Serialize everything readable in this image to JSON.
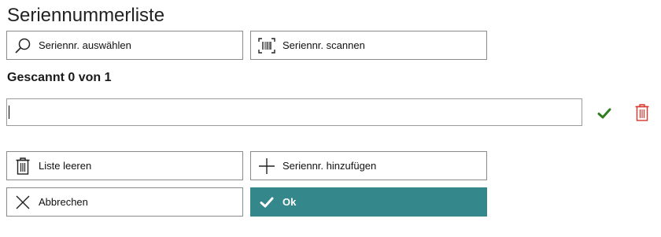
{
  "header": {
    "title": "Seriennummerliste"
  },
  "toolbar": {
    "select_label": "Seriennr. auswählen",
    "scan_label": "Seriennr. scannen"
  },
  "status": {
    "text": "Gescannt 0 von 1"
  },
  "serial_input": {
    "value": "",
    "placeholder": ""
  },
  "actions": {
    "clear_label": "Liste leeren",
    "add_label": "Seriennr. hinzufügen",
    "cancel_label": "Abbrechen",
    "ok_label": "Ok"
  },
  "colors": {
    "primary": "#34878a",
    "confirm_green": "#2e7d1e",
    "delete_red": "#d9362b"
  },
  "icons": {
    "select": "search-icon",
    "scan": "barcode-scan-icon",
    "confirm": "checkmark-icon",
    "delete": "trash-icon",
    "clear": "trash-icon",
    "add": "plus-icon",
    "cancel": "close-icon",
    "ok": "checkmark-icon"
  }
}
